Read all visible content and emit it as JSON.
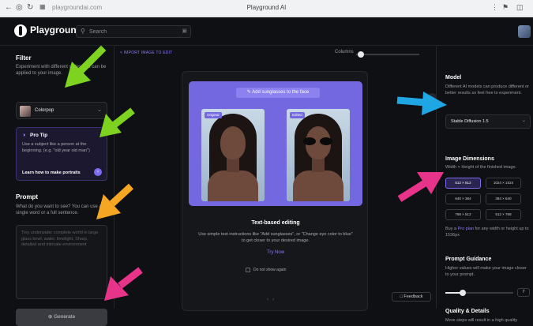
{
  "browser": {
    "url": "playgroundai.com",
    "tab_title": "Playground AI"
  },
  "header": {
    "brand": "Playground",
    "search_placeholder": "Search"
  },
  "filter": {
    "title": "Filter",
    "description": "Experiment with different styles that can be applied to your image.",
    "selected": "Colorpop"
  },
  "pro_tip": {
    "title": "Pro Tip",
    "body": "Use a subject like a person at the beginning. (e.g. \"old year old man\")",
    "link": "Learn how to make portraits"
  },
  "prompt": {
    "title": "Prompt",
    "description": "What do you want to see? You can use a single word or a full sentence.",
    "placeholder": "Tiny underwater complete world in large glass bowl, water, limelight, Sharp, detailed and intricate environment"
  },
  "generate_label": "Generate",
  "canvas": {
    "import_link": "< IMPORT IMAGE TO EDIT",
    "columns_label": "Columns"
  },
  "modal": {
    "chip": "Add sunglasses to the face",
    "tag_original": "Original",
    "tag_edited": "Edited",
    "title": "Text-based editing",
    "body": "Use simple text instructions like \"Add sunglasses\", or \"Change eye color to blue\" to get closer to your desired image.",
    "try_now": "Try Now",
    "dont_show": "Do not show again"
  },
  "feedback_label": "Feedback",
  "model": {
    "title": "Model",
    "description": "Different AI models can produce different or better results so feel free to experiment.",
    "selected": "Stable Diffusion 1.5"
  },
  "dimensions": {
    "title": "Image Dimensions",
    "description": "Width × Height of the finished image.",
    "options": [
      "512 × 512",
      "1024 × 1024",
      "640 × 384",
      "384 × 640",
      "768 × 512",
      "512 × 768"
    ],
    "selected_index": 0,
    "pro_prefix": "Buy a ",
    "pro_link": "Pro plan",
    "pro_suffix": " for any width or height up to 1536px"
  },
  "guidance": {
    "title": "Prompt Guidance",
    "description": "Higher values will make your image closer to your prompt.",
    "value": "7",
    "fraction": 0.25
  },
  "quality": {
    "title": "Quality & Details",
    "description": "More steps will result in a high quality"
  },
  "colors": {
    "accent": "#7c6cf0",
    "arrow_green": "#7ed321",
    "arrow_orange": "#f5a623",
    "arrow_blue": "#1ea7e4",
    "arrow_pink": "#e8338a"
  }
}
